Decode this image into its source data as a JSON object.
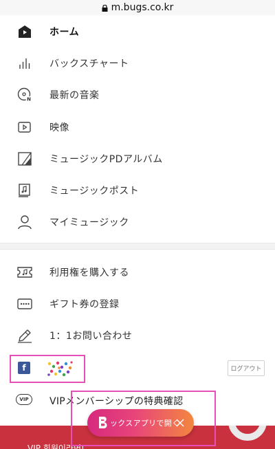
{
  "browser": {
    "url": "m.bugs.co.kr"
  },
  "menu": {
    "items": [
      {
        "label": "ホーム",
        "icon": "home-icon"
      },
      {
        "label": "バックスチャート",
        "icon": "chart-icon"
      },
      {
        "label": "最新の音楽",
        "icon": "new-music-icon"
      },
      {
        "label": "映像",
        "icon": "video-icon"
      },
      {
        "label": "ミュージックPDアルバム",
        "icon": "pd-album-icon"
      },
      {
        "label": "ミュージックポスト",
        "icon": "music-post-icon"
      },
      {
        "label": "マイミュージック",
        "icon": "my-music-icon"
      }
    ],
    "items2": [
      {
        "label": "利用権を購入する",
        "icon": "ticket-icon"
      },
      {
        "label": "ギフト券の登録",
        "icon": "gift-card-icon"
      },
      {
        "label": "1：1お問い合わせ",
        "icon": "pencil-icon"
      }
    ]
  },
  "account": {
    "badge": "f",
    "logout_label": "ログアウト"
  },
  "vip": {
    "badge": "VIP",
    "label": "VIPメンバーシップの特典確認"
  },
  "app_banner": {
    "label": "ックスアプリで開く"
  },
  "bottom_banner": {
    "text": "VIP 회원이라면!"
  },
  "colors": {
    "facebook": "#3b5998",
    "highlight": "#e64fb8",
    "banner_red": "#c8313d"
  }
}
